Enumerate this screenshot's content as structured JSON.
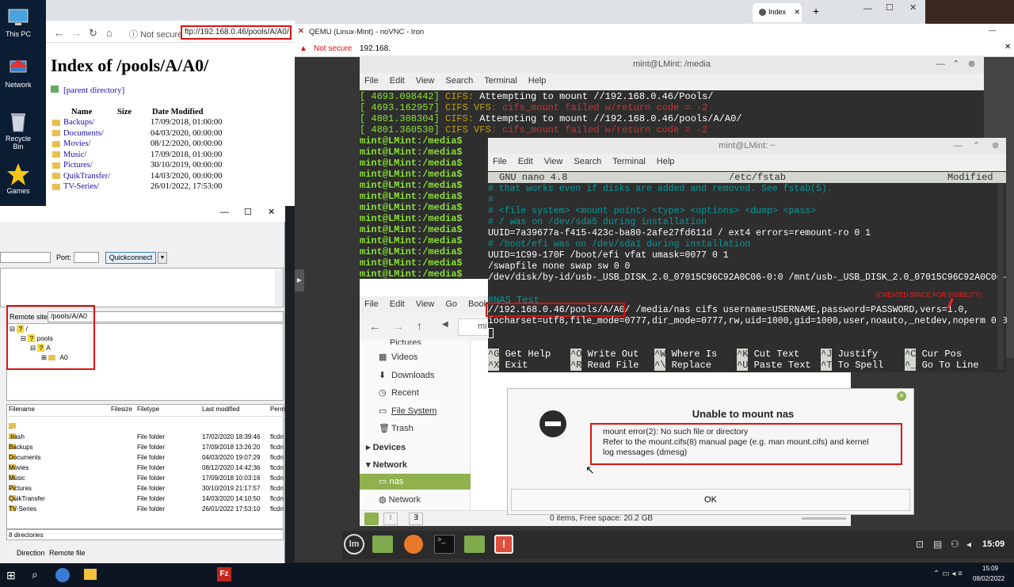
{
  "desktop": {
    "icons": [
      {
        "label": "This PC",
        "icon": "computer-icon"
      },
      {
        "label": "Network",
        "icon": "network-icon"
      },
      {
        "label": "Recycle Bin",
        "icon": "recycle-bin-icon"
      },
      {
        "label": "Games",
        "icon": "star-icon"
      }
    ]
  },
  "browser": {
    "tab_title": "Index",
    "not_secure": "Not secure",
    "url": "ftp://192.168.0.46/pools/A/A0/",
    "heading": "Index of /pools/A/A0/",
    "parent_link": "[parent directory]",
    "columns": [
      "Name",
      "Size",
      "Date Modified"
    ],
    "rows": [
      {
        "name": "Backups/",
        "date": "17/09/2018, 01:00:00"
      },
      {
        "name": "Documents/",
        "date": "04/03/2020, 00:00:00"
      },
      {
        "name": "Movies/",
        "date": "08/12/2020, 00:00:00"
      },
      {
        "name": "Music/",
        "date": "17/09/2018, 01:00:00"
      },
      {
        "name": "Pictures/",
        "date": "30/10/2019, 00:00:00"
      },
      {
        "name": "QuikTransfer/",
        "date": "14/03/2020, 00:00:00"
      },
      {
        "name": "TV-Series/",
        "date": "26/01/2022, 17:53:00"
      }
    ]
  },
  "filezilla": {
    "port_label": "Port:",
    "quickconnect": "Quickconnect",
    "remote_site_label": "Remote site:",
    "remote_site_value": "/pools/A/A0",
    "tree": [
      "/",
      "pools",
      "A",
      "A0"
    ],
    "columns": [
      "Filename",
      "Filesize",
      "Filetype",
      "Last modified",
      "Perm"
    ],
    "files": [
      {
        "name": "..",
        "type": "",
        "modified": "",
        "perm": ""
      },
      {
        "name": ".trash",
        "type": "File folder",
        "modified": "17/02/2020 18:39:46",
        "perm": "flcdn"
      },
      {
        "name": "Backups",
        "type": "File folder",
        "modified": "17/09/2018 13:26:20",
        "perm": "flcdn"
      },
      {
        "name": "Documents",
        "type": "File folder",
        "modified": "04/03/2020 19:07:29",
        "perm": "flcdn"
      },
      {
        "name": "Movies",
        "type": "File folder",
        "modified": "08/12/2020 14:42:36",
        "perm": "flcdn"
      },
      {
        "name": "Music",
        "type": "File folder",
        "modified": "17/09/2018 10:03:16",
        "perm": "flcdn"
      },
      {
        "name": "Pictures",
        "type": "File folder",
        "modified": "30/10/2019 21:17:57",
        "perm": "flcdn"
      },
      {
        "name": "QuikTransfer",
        "type": "File folder",
        "modified": "14/03/2020 14:10:50",
        "perm": "flcdn"
      },
      {
        "name": "TV-Series",
        "type": "File folder",
        "modified": "26/01/2022 17:53:10",
        "perm": "flcdn"
      }
    ],
    "status": "8 directories",
    "queue_cols": [
      "Direction",
      "Remote file"
    ]
  },
  "qemu": {
    "title": "QEMU (Linux-Mint) - noVNC - Iron",
    "not_secure": "Not secure",
    "address": "192.168."
  },
  "term1": {
    "title": "mint@LMint: /media",
    "menu": [
      "File",
      "Edit",
      "View",
      "Search",
      "Terminal",
      "Help"
    ],
    "log": [
      {
        "ts": "[ 4693.098442]",
        "tag": "CIFS:",
        "msg": " Attempting to mount //192.168.0.46/Pools/"
      },
      {
        "ts": "[ 4693.162957]",
        "tag": "CIFS VFS",
        "msg": ": cifs_mount failed w/return code = -2"
      },
      {
        "ts": "[ 4801.308304]",
        "tag": "CIFS:",
        "msg": " Attempting to mount //192.168.0.46/pools/A/A0/"
      },
      {
        "ts": "[ 4801.360530]",
        "tag": "CIFS VFS",
        "msg": ": cifs_mount failed w/return code = -2"
      }
    ],
    "prompt": "mint@LMint:/media$"
  },
  "term2": {
    "title": "mint@LMint: ~",
    "menu": [
      "File",
      "Edit",
      "View",
      "Search",
      "Terminal",
      "Help"
    ],
    "nano_version": "GNU nano 4.8",
    "nano_file": "/etc/fstab",
    "nano_status": "Modified",
    "lines": [
      "# that works even if disks are added and removed. See fstab(5).",
      "#",
      "# <file system> <mount point>   <type>  <options>       <dump>  <pass>",
      "# / was on /dev/sda5 during installation",
      "UUID=7a39677a-f415-423c-ba80-2afe27fd611d /               ext4    errors=remount-ro 0       1",
      "# /boot/efi was on /dev/sda1 during installation",
      "UUID=1C99-170F  /boot/efi       vfat    umask=0077      0       1",
      "/swapfile                                 none            swap    sw              0       0",
      "/dev/disk/by-id/usb-_USB_DISK_2.0_07015C96C92A0C06-0:0 /mnt/usb-_USB_DISK_2.0_07015C96C92A0C06-0:"
    ],
    "nas_comment": "#NAS Test",
    "created_space": "(CREATED SPACE FOR VISIBILITY)",
    "nas_share": "//192.168.0.46/pools/A/A0/",
    "nas_rest": " /media/nas cifs username=USERNAME,password=PASSWORD,vers=1.0,",
    "nas_line2": "iocharset=utf8,file_mode=0777,dir_mode=0777,rw,uid=1000,gid=1000,user,noauto,_netdev,noperm 0 0",
    "shortcuts": [
      {
        "k1": "^G",
        "l1": "Get Help",
        "k2": "^X",
        "l2": "Exit"
      },
      {
        "k1": "^O",
        "l1": "Write Out",
        "k2": "^R",
        "l2": "Read File"
      },
      {
        "k1": "^W",
        "l1": "Where Is",
        "k2": "^\\",
        "l2": "Replace"
      },
      {
        "k1": "^K",
        "l1": "Cut Text",
        "k2": "^U",
        "l2": "Paste Text"
      },
      {
        "k1": "^J",
        "l1": "Justify",
        "k2": "^T",
        "l2": "To Spell"
      },
      {
        "k1": "^C",
        "l1": "Cur Pos",
        "k2": "^_",
        "l2": "Go To Line"
      }
    ]
  },
  "nemo": {
    "menu": [
      "File",
      "Edit",
      "View",
      "Go",
      "Book"
    ],
    "path_fragment": "mi",
    "sidebar_partial": "Pictures",
    "sidebar": [
      {
        "label": "Videos",
        "icon": "video-icon"
      },
      {
        "label": "Downloads",
        "icon": "download-icon"
      },
      {
        "label": "Recent",
        "icon": "recent-icon"
      },
      {
        "label": "File System",
        "icon": "drive-icon"
      },
      {
        "label": "Trash",
        "icon": "trash-icon"
      }
    ],
    "devices": "Devices",
    "network": "Network",
    "nas": "nas",
    "network_item": "Network",
    "status": "0 items, Free space: 20.2 GB"
  },
  "dialog": {
    "title": "Unable to mount nas",
    "line1": "mount error(2): No such file or directory",
    "line2": "Refer to the mount.cifs(8) manual page (e.g. man mount.cifs) and kernel",
    "line3": "log messages (dmesg)",
    "ok": "OK"
  },
  "mint_panel": {
    "clock": "15:09"
  },
  "win_taskbar": {
    "time": "15:09",
    "date": "08/02/2022"
  }
}
